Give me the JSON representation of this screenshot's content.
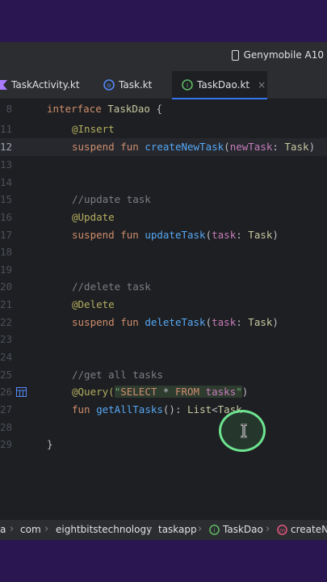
{
  "toolbar": {
    "device": "Genymobile A10"
  },
  "tabs": [
    {
      "label": "TaskActivity.kt",
      "icon": "kotlin-class-icon"
    },
    {
      "label": "Task.kt",
      "icon": "kotlin-object-icon"
    },
    {
      "label": "TaskDao.kt",
      "icon": "kotlin-interface-icon",
      "active": true,
      "close": "×"
    }
  ],
  "editor": {
    "lines": [
      {
        "n": "8"
      },
      {
        "n": "11"
      },
      {
        "n": "12"
      },
      {
        "n": "13"
      },
      {
        "n": "14"
      },
      {
        "n": "15"
      },
      {
        "n": "16"
      },
      {
        "n": "17"
      },
      {
        "n": "18"
      },
      {
        "n": "19"
      },
      {
        "n": "20"
      },
      {
        "n": "21"
      },
      {
        "n": "22"
      },
      {
        "n": "23"
      },
      {
        "n": "24"
      },
      {
        "n": "25"
      },
      {
        "n": "26"
      },
      {
        "n": "27"
      },
      {
        "n": "28"
      },
      {
        "n": "29"
      }
    ],
    "tokens": {
      "interface": "interface",
      "taskdao": "TaskDao",
      "open_brace": " {",
      "insert_ann": "@Insert",
      "suspend": "suspend",
      "fun": "fun",
      "createNewTask": "createNewTask",
      "newTask": "newTask",
      "colon": ": ",
      "task_type": "Task",
      "close_paren": ")",
      "open_paren": "(",
      "cmt_update": "//update task",
      "update_ann": "@Update",
      "updateTask": "updateTask",
      "task_param": "task",
      "cmt_delete": "//delete task",
      "delete_ann": "@Delete",
      "deleteTask": "deleteTask",
      "cmt_get": "//get all tasks",
      "query_ann": "@Query(",
      "quote_open": "\"",
      "select": "SELECT",
      "star": " * ",
      "from": "FROM",
      "space": " ",
      "tasks": "tasks",
      "quote_close": "\"",
      "getAllTasks": "getAllTasks",
      "call_colon": "(): ",
      "list": "List",
      "lt": "<",
      "task_partial": "Task",
      "close_brace": "}"
    }
  },
  "breadcrumb": {
    "items": [
      "a",
      "com",
      "eightbitstechnology",
      "taskapp",
      "TaskDao",
      "createNe"
    ],
    "separator": "›"
  }
}
